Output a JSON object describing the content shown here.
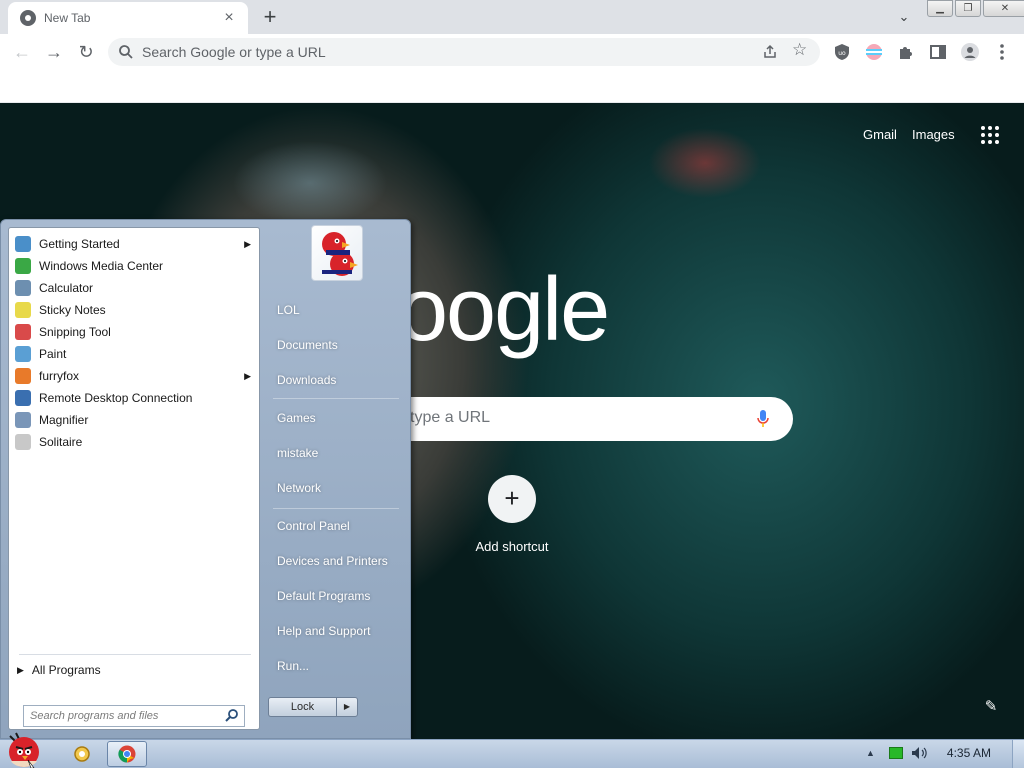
{
  "browser": {
    "tab": {
      "title": "New Tab",
      "close_icon": "close-icon"
    },
    "omnibox": {
      "placeholder": "Search Google or type a URL"
    }
  },
  "ntp": {
    "links": {
      "gmail": "Gmail",
      "images": "Images"
    },
    "logo_text": "Google",
    "search_text": "type a URL",
    "add_shortcut": {
      "symbol": "+",
      "label": "Add shortcut"
    },
    "customize_icon": "pencil-icon"
  },
  "start_menu": {
    "programs": [
      {
        "label": "Getting Started",
        "has_submenu": true,
        "color": "#4a8fc9"
      },
      {
        "label": "Windows Media Center",
        "has_submenu": false,
        "color": "#3aa845"
      },
      {
        "label": "Calculator",
        "has_submenu": false,
        "color": "#6d8fb0"
      },
      {
        "label": "Sticky Notes",
        "has_submenu": false,
        "color": "#e8d94a"
      },
      {
        "label": "Snipping Tool",
        "has_submenu": false,
        "color": "#d94a4a"
      },
      {
        "label": "Paint",
        "has_submenu": false,
        "color": "#5a9fd4"
      },
      {
        "label": "furryfox",
        "has_submenu": true,
        "color": "#e87a2a"
      },
      {
        "label": "Remote Desktop Connection",
        "has_submenu": false,
        "color": "#3a6fb0"
      },
      {
        "label": "Magnifier",
        "has_submenu": false,
        "color": "#7a96b8"
      },
      {
        "label": "Solitaire",
        "has_submenu": false,
        "color": "#c8c8c8"
      }
    ],
    "all_programs": "All Programs",
    "search_placeholder": "Search programs and files",
    "right_items": [
      {
        "label": "LOL"
      },
      {
        "label": "Documents"
      },
      {
        "label": "Downloads"
      },
      {
        "label": "Games"
      },
      {
        "label": "mistake"
      },
      {
        "label": "Network"
      },
      {
        "label": "Control Panel"
      },
      {
        "label": "Devices and Printers"
      },
      {
        "label": "Default Programs"
      },
      {
        "label": "Help and Support"
      },
      {
        "label": "Run..."
      }
    ],
    "lock_label": "Lock"
  },
  "taskbar": {
    "clock": "4:35 AM"
  }
}
